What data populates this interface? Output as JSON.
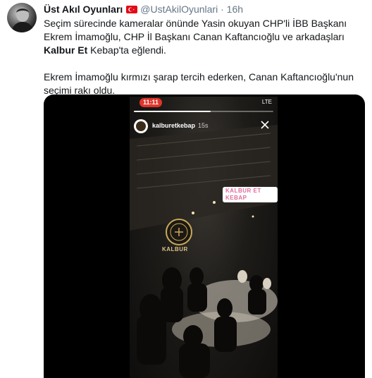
{
  "tweet": {
    "author_name": "Üst Akıl Oyunları",
    "handle": "@UstAkilOyunlari",
    "separator": "·",
    "time": "16h",
    "paragraph1_text": "Seçim sürecinde kameralar önünde Yasin okuyan CHP'li İBB Başkanı Ekrem İmamoğlu, CHP İl Başkanı Canan Kaftancıoğlu ve arkadaşları ",
    "paragraph1_bold": "Kalbur Et",
    "paragraph1_end": " Kebap'ta eğlendi.",
    "paragraph2": "Ekrem İmamoğlu kırmızı şarap tercih ederken, Canan Kaftancıoğlu'nun seçimi rakı oldu."
  },
  "video": {
    "status_time": "11:11",
    "status_right": "LTE",
    "story_username": "kalburetkebap",
    "story_age": "15s",
    "location_sticker": "KALBUR ET KEBAP",
    "venue_sign": "KALBUR",
    "progress_fraction": 0.55
  },
  "icons": {
    "flag": "turkey-flag-icon",
    "close": "close-icon"
  },
  "colors": {
    "text": "#14171a",
    "secondary": "#657786",
    "flag": "#e30a17",
    "status_pill": "#e0352b",
    "sticker_text": "#e06b9a"
  }
}
